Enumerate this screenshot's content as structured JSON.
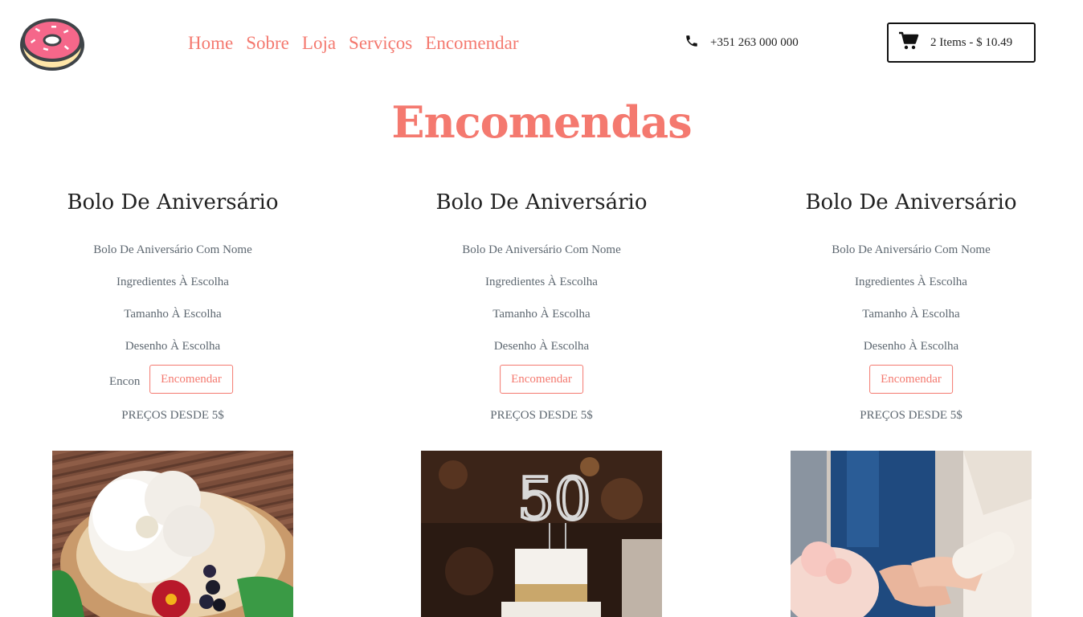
{
  "brand": {
    "logo_icon": "donut-icon"
  },
  "nav": {
    "items": [
      "Home",
      "Sobre",
      "Loja",
      "Serviços",
      "Encomendar"
    ]
  },
  "contact": {
    "phone": "+351 263 000 000",
    "icon": "phone-icon"
  },
  "cart": {
    "summary": "2 Items - $ 10.49",
    "icon": "cart-icon"
  },
  "page": {
    "title": "Encomendas"
  },
  "cards": [
    {
      "title": "Bolo De Aniversário",
      "features": [
        "Bolo De Aniversário Com Nome",
        "Ingredientes À Escolha",
        "Tamanho À Escolha",
        "Desenho À Escolha"
      ],
      "button": "Encomendar",
      "partial_text": "Encon",
      "price": "PREÇOS DESDE 5$",
      "image": "cake-with-white-flower-photo"
    },
    {
      "title": "Bolo De Aniversário",
      "features": [
        "Bolo De Aniversário Com Nome",
        "Ingredientes À Escolha",
        "Tamanho À Escolha",
        "Desenho À Escolha"
      ],
      "button": "Encomendar",
      "price": "PREÇOS DESDE 5$",
      "image": "cake-with-50-topper-photo"
    },
    {
      "title": "Bolo De Aniversário",
      "features": [
        "Bolo De Aniversário Com Nome",
        "Ingredientes À Escolha",
        "Tamanho À Escolha",
        "Desenho À Escolha"
      ],
      "button": "Encomendar",
      "price": "PREÇOS DESDE 5$",
      "image": "hands-cutting-cake-photo"
    }
  ],
  "colors": {
    "accent": "#f4796f",
    "text_dark": "#222222",
    "text_muted": "#5d6770"
  }
}
